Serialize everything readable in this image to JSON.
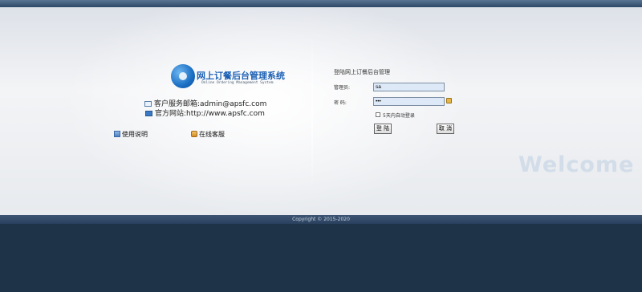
{
  "brand": {
    "title": "网上订餐后台管理系统",
    "subtitle": "Online Ordering Management System"
  },
  "contact": {
    "email_label": "客户服务邮箱:admin@apsfc.com",
    "website_label": "官方网站:http://www.apsfc.com"
  },
  "links": {
    "help": "使用说明",
    "service": "在线客服"
  },
  "login": {
    "title": "登陆网上订餐后台管理",
    "username_label": "管理员:",
    "username_value": "sa",
    "password_label": "密  码:",
    "password_value": "•••",
    "remember_label": "5天内自动登录",
    "login_button": "登 陆",
    "cancel_button": "取 消"
  },
  "welcome_text": "Welcome",
  "footer": {
    "copyright": "Copyright © 2015-2020"
  },
  "icons": {
    "logo": "logo-icon",
    "email": "mail-icon",
    "website": "web-icon",
    "help": "help-icon",
    "service": "service-icon",
    "password_hint": "lock-icon"
  },
  "colors": {
    "header_bar": "#2c4866",
    "footer_bg": "#1e3248",
    "brand_blue": "#1b5fb3",
    "input_bg": "#dde9f7"
  }
}
